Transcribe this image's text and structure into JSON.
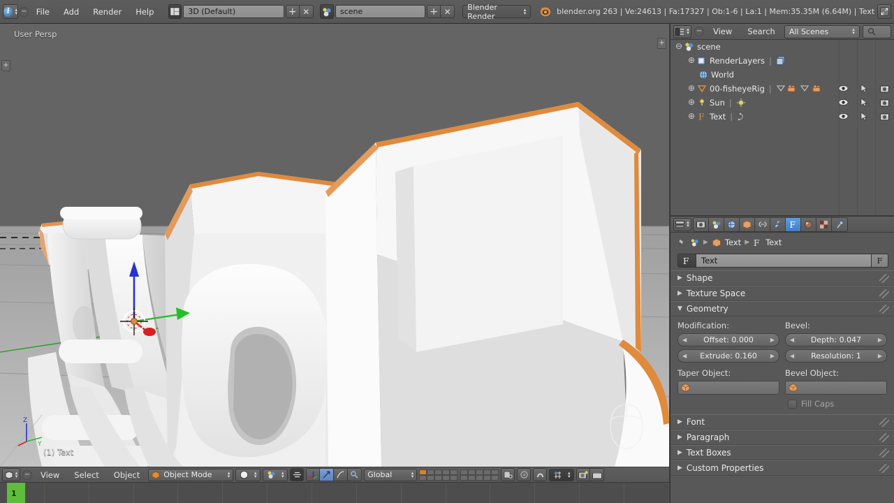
{
  "topbar": {
    "info_icon": "info-icon",
    "collapse_icon": "collapse-menus-icon",
    "menus": [
      "File",
      "Add",
      "Render",
      "Help"
    ],
    "screen_layout": {
      "icon": "screen-layout-icon",
      "value": "3D (Default)",
      "add": "+",
      "remove": "✕"
    },
    "scene": {
      "icon": "scene-icon",
      "value": "scene",
      "add": "+",
      "remove": "✕"
    },
    "engine": {
      "value": "Blender Render"
    },
    "status": "blender.org 263 | Ve:24613 | Fa:17327 | Ob:1-6 | La:1 | Mem:35.35M (6.64M) | Text",
    "maximize_icon": "maximize-area-icon"
  },
  "viewport": {
    "view_label": "User Persp",
    "object_label": "(1) Text",
    "tab_handle": "+",
    "axis_gizmo": {
      "z": "Z",
      "y": "Y",
      "x": "X"
    },
    "footer": {
      "editor_icon": "editor-type-3dview-icon",
      "collapse_icon": "collapse-menus-icon",
      "menus": [
        "View",
        "Select",
        "Object"
      ],
      "mode": {
        "icon": "object-mode-icon",
        "value": "Object Mode"
      },
      "shading": {
        "icon": "viewport-shading-solid-icon"
      },
      "pivot": {
        "icon": "pivot-point-icon"
      },
      "manipulator_toggle": "manipulator-icon",
      "manipulator_translate": "translate-manipulator-icon",
      "manipulator_rotate": "rotate-manipulator-icon",
      "manipulator_scale": "scale-manipulator-icon",
      "orientation": "Global",
      "layers_active": 0,
      "proportional_icon": "proportional-edit-icon",
      "proportional_falloff_icon": "smooth-falloff-icon",
      "snap_icon": "snap-magnet-icon",
      "snap_element_icon": "snap-increment-icon",
      "render_still_icon": "render-image-icon",
      "render_anim_icon": "render-animation-icon"
    }
  },
  "timeline": {
    "current_frame": "1"
  },
  "outliner": {
    "header": {
      "editor_icon": "editor-type-outliner-icon",
      "collapse_icon": "collapse-menus-icon",
      "menus": [
        "View",
        "Search"
      ],
      "display_mode": "All Scenes",
      "search_icon": "search-icon"
    },
    "rows": [
      {
        "indent": 0,
        "expander": "⊖",
        "icon": "scene-icon",
        "name": "scene",
        "restrict": false
      },
      {
        "indent": 1,
        "expander": "⊕",
        "icon": "renderlayers-icon",
        "name": "RenderLayers",
        "extra_icon": "renderlayer-stack-icon",
        "restrict": false
      },
      {
        "indent": 2,
        "expander": "",
        "icon": "world-icon",
        "name": "World",
        "restrict": false
      },
      {
        "indent": 1,
        "expander": "⊕",
        "icon": "empty-cone-icon",
        "name": "00-fisheyeRig",
        "extra_icon": "camera-rig-icons",
        "restrict": true
      },
      {
        "indent": 1,
        "expander": "⊕",
        "icon": "lamp-sun-icon",
        "name": "Sun",
        "extra_icon": "lamp-data-icon",
        "restrict": true
      },
      {
        "indent": 1,
        "expander": "⊕",
        "icon": "font-data-icon",
        "name": "Text",
        "extra_icon": "curve-data-icon",
        "restrict": true
      }
    ],
    "restrict_icons": [
      "restrict-view-eye-icon",
      "restrict-select-cursor-icon",
      "restrict-render-camera-icon"
    ]
  },
  "properties": {
    "tabs": [
      {
        "name": "render-tab",
        "icon": "camera-back-icon",
        "active": false
      },
      {
        "name": "scene-tab",
        "icon": "scene-icon",
        "active": false
      },
      {
        "name": "world-tab",
        "icon": "world-icon",
        "active": false
      },
      {
        "name": "object-tab",
        "icon": "object-cube-icon",
        "active": false
      },
      {
        "name": "constraints-tab",
        "icon": "chain-link-icon",
        "active": false
      },
      {
        "name": "modifiers-tab",
        "icon": "wrench-icon",
        "active": false
      },
      {
        "name": "data-tab",
        "icon": "font-data-icon",
        "active": true
      },
      {
        "name": "material-tab",
        "icon": "material-sphere-icon",
        "active": false
      },
      {
        "name": "texture-tab",
        "icon": "checker-texture-icon",
        "active": false
      },
      {
        "name": "physics-tab",
        "icon": "physics-icon",
        "active": false
      }
    ],
    "breadcrumb": {
      "pin_icon": "pin-icon",
      "scene_icon": "scene-icon",
      "object_icon": "object-cube-icon",
      "object_name": "Text",
      "data_icon": "font-data-icon",
      "data_name": "Text"
    },
    "name_field": {
      "prefix_icon": "font-data-icon",
      "value": "Text",
      "fake_user": "F"
    },
    "panels": [
      {
        "label": "Shape",
        "open": false
      },
      {
        "label": "Texture Space",
        "open": false
      },
      {
        "label": "Geometry",
        "open": true
      },
      {
        "label": "Font",
        "open": false
      },
      {
        "label": "Paragraph",
        "open": false
      },
      {
        "label": "Text Boxes",
        "open": false
      },
      {
        "label": "Custom Properties",
        "open": false
      }
    ],
    "geometry": {
      "modification_label": "Modification:",
      "bevel_label": "Bevel:",
      "offset": "Offset: 0.000",
      "extrude": "Extrude: 0.160",
      "depth": "Depth: 0.047",
      "resolution": "Resolution: 1",
      "taper_object_label": "Taper Object:",
      "bevel_object_label": "Bevel Object:",
      "taper_object_value": "",
      "bevel_object_value": "",
      "fill_caps_label": "Fill Caps",
      "fill_caps_checked": false
    }
  },
  "colors": {
    "accent_orange": "#e08a3c",
    "selected_blue": "#4a86c8",
    "timeline_green": "#5fbd3b",
    "header_gray": "#5c5c5c",
    "viewport_bg": "#5b5b5b"
  }
}
